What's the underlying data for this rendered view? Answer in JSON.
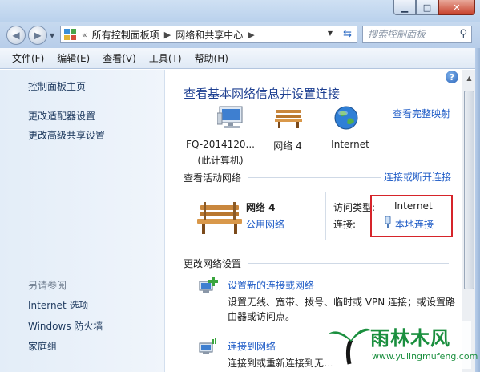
{
  "address": {
    "overflow": "«",
    "path": [
      "所有控制面板项",
      "网络和共享中心"
    ],
    "search_placeholder": "搜索控制面板"
  },
  "menu": [
    "文件(F)",
    "编辑(E)",
    "查看(V)",
    "工具(T)",
    "帮助(H)"
  ],
  "sidebar": {
    "links": [
      "控制面板主页",
      "更改适配器设置",
      "更改高级共享设置"
    ],
    "see_also_heading": "另请参阅",
    "see_also": [
      "Internet 选项",
      "Windows 防火墙",
      "家庭组"
    ]
  },
  "main": {
    "title": "查看基本网络信息并设置连接",
    "full_map_link": "查看完整映射",
    "diagram": {
      "computer_name": "FQ-2014120...",
      "computer_sub": "(此计算机)",
      "network": "网络  4",
      "internet": "Internet"
    },
    "active_section": "查看活动网络",
    "connect_disconnect": "连接或断开连接",
    "active": {
      "name": "网络  4",
      "type": "公用网络",
      "access_type_label": "访问类型:",
      "access_type_value": "Internet",
      "connection_label": "连接:",
      "connection_value": "本地连接"
    },
    "change_section": "更改网络设置",
    "tasks": [
      {
        "title": "设置新的连接或网络",
        "desc": "设置无线、宽带、拨号、临时或 VPN 连接；或设置路由器或访问点。"
      },
      {
        "title": "连接到网络",
        "desc": "连接到或重新连接到无..."
      }
    ]
  },
  "watermark": {
    "text": "雨林木风",
    "url": "www.yulingmufeng.com"
  },
  "colors": {
    "link": "#1c5ac6",
    "title": "#1d3f91",
    "highlight": "#d6242a"
  }
}
